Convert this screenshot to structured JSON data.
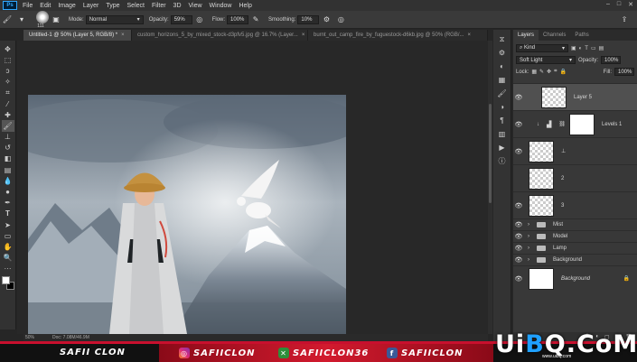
{
  "menu": [
    "File",
    "Edit",
    "Image",
    "Layer",
    "Type",
    "Select",
    "Filter",
    "3D",
    "View",
    "Window",
    "Help"
  ],
  "app_logo": "Ps",
  "window_controls": [
    "–",
    "□",
    "✕"
  ],
  "options": {
    "brush_size": "111",
    "mode_label": "Mode:",
    "mode_value": "Normal",
    "opacity_label": "Opacity:",
    "opacity_value": "59%",
    "flow_label": "Flow:",
    "flow_value": "100%",
    "smoothing_label": "Smoothing:",
    "smoothing_value": "10%"
  },
  "tabs": [
    {
      "label": "Untitled-1 @ 50% (Layer 5, RGB/8) *",
      "active": true
    },
    {
      "label": "custom_horizons_5_by_mixed_stock-d3pfv5.jpg @ 16.7% (Layer...",
      "active": false
    },
    {
      "label": "burnt_out_camp_fire_by_fuguestock-d6kb.jpg @ 50% (RGB/...",
      "active": false
    }
  ],
  "status": {
    "zoom": "50%",
    "doc": "Doc: 7.08M/46.9M"
  },
  "layers_panel": {
    "tabs": [
      "Layers",
      "Channels",
      "Paths"
    ],
    "filter_value": "Kind",
    "blend_value": "Soft Light",
    "opacity_label": "Opacity:",
    "opacity_value": "100%",
    "lock_label": "Lock:",
    "fill_label": "Fill:",
    "fill_value": "100%",
    "layers": [
      {
        "name": "Layer 5",
        "kind": "pixel",
        "selected": true
      },
      {
        "name": "Levels 1",
        "kind": "adjustment"
      },
      {
        "name": "",
        "kind": "pixel"
      },
      {
        "name": "2",
        "kind": "pixel"
      },
      {
        "name": "3",
        "kind": "pixel"
      },
      {
        "name": "Mist",
        "kind": "group"
      },
      {
        "name": "Model",
        "kind": "group"
      },
      {
        "name": "Lamp",
        "kind": "group"
      },
      {
        "name": "Background",
        "kind": "group"
      },
      {
        "name": "Background",
        "kind": "background"
      }
    ],
    "footer_icons": [
      "fx",
      "◐",
      "▢",
      "▣",
      "🗑"
    ]
  },
  "banner": {
    "name": "SAFII CLON",
    "instagram": "SAFIICLON",
    "twitch": "SAFIICLON36",
    "facebook": "SAFIICLON"
  },
  "watermark": {
    "pre": "Ui",
    "o": "B",
    "post": "Q.CoM",
    "sub": "www.uibq.com"
  },
  "colors": {
    "accent": "#31a8ff",
    "banner_red": "#d21a2e"
  }
}
